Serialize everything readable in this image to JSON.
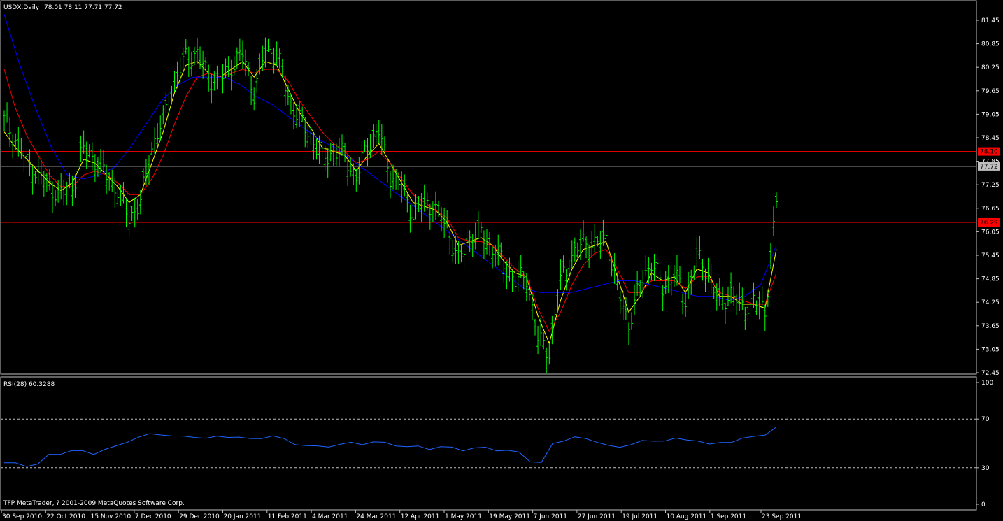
{
  "chart_data": [
    {
      "type": "line",
      "title": "USDX,Daily",
      "ohlc_header": "78.01 78.11 77.71 77.72",
      "ylim": [
        72.45,
        81.75
      ],
      "y_ticks": [
        "81.45",
        "80.85",
        "80.25",
        "79.65",
        "79.05",
        "78.45",
        "77.85",
        "77.25",
        "76.65",
        "76.05",
        "75.45",
        "74.85",
        "74.25",
        "73.65",
        "73.05",
        "72.45"
      ],
      "x_ticks": [
        "30 Sep 2010",
        "22 Oct 2010",
        "15 Nov 2010",
        "7 Dec 2010",
        "29 Dec 2010",
        "20 Jan 2011",
        "11 Feb 2011",
        "4 Mar 2011",
        "24 Mar 2011",
        "12 Apr 2011",
        "1 May 2011",
        "19 May 2011",
        "7 Jun 2011",
        "27 Jun 2011",
        "19 Jul 2011",
        "10 Aug 2011",
        "1 Sep 2011",
        "23 Sep 2011"
      ],
      "hlines": [
        {
          "value": 78.1,
          "label": "78.10",
          "color": "#ff0000"
        },
        {
          "value": 77.72,
          "label": "77.72",
          "color": "#c0c0c0"
        },
        {
          "value": 76.29,
          "label": "76.29",
          "color": "#ff0000"
        }
      ],
      "colors": {
        "bars": "#00ff00",
        "ma_fast": "#ffff00",
        "ma_mid": "#ff0000",
        "ma_slow": "#0000ff"
      },
      "x": [
        0,
        4,
        8,
        12,
        16,
        20,
        24,
        28,
        32,
        36,
        40,
        44,
        48,
        52,
        56,
        60,
        64,
        68,
        72,
        76,
        80,
        84,
        88,
        92,
        96,
        100,
        104,
        108,
        112,
        116,
        120,
        124,
        128,
        132,
        136,
        140,
        144,
        148,
        152,
        156,
        160,
        164,
        168,
        172,
        176,
        180,
        184,
        188,
        192,
        196,
        200,
        204,
        208,
        212,
        216,
        220,
        224,
        228,
        232,
        236,
        240,
        244,
        248,
        252,
        256,
        260,
        264,
        268,
        272
      ],
      "close": [
        78.9,
        78.4,
        77.8,
        77.5,
        77.2,
        77.0,
        77.2,
        78.2,
        77.9,
        77.5,
        77.1,
        76.4,
        76.8,
        78.2,
        78.9,
        79.9,
        80.5,
        80.6,
        80.0,
        79.9,
        80.3,
        80.6,
        79.6,
        80.7,
        80.6,
        79.5,
        78.9,
        78.5,
        77.9,
        78.1,
        78.0,
        77.4,
        78.3,
        78.6,
        77.5,
        77.2,
        76.5,
        76.8,
        76.6,
        76.2,
        75.3,
        75.9,
        76.0,
        75.6,
        75.2,
        74.8,
        74.9,
        73.3,
        73.0,
        74.8,
        75.4,
        75.8,
        75.7,
        75.9,
        74.6,
        73.7,
        74.7,
        75.3,
        74.6,
        75.0,
        74.3,
        75.4,
        75.0,
        74.2,
        74.5,
        74.1,
        74.3,
        74.0,
        76.8
      ],
      "series": [
        {
          "name": "",
          "values": [
            78.6,
            78.2,
            77.9,
            77.6,
            77.3,
            77.1,
            77.3,
            77.9,
            77.8,
            77.5,
            77.2,
            76.8,
            77.0,
            77.8,
            78.6,
            79.6,
            80.3,
            80.4,
            80.1,
            80.0,
            80.2,
            80.4,
            80.0,
            80.4,
            80.3,
            79.7,
            79.1,
            78.7,
            78.2,
            78.1,
            78.0,
            77.6,
            78.0,
            78.3,
            77.8,
            77.3,
            76.8,
            76.7,
            76.6,
            76.3,
            75.7,
            75.8,
            75.9,
            75.7,
            75.3,
            75.0,
            74.9,
            73.9,
            73.2,
            74.3,
            75.1,
            75.6,
            75.7,
            75.8,
            74.9,
            74.0,
            74.4,
            75.0,
            74.8,
            74.9,
            74.5,
            75.1,
            75.0,
            74.4,
            74.4,
            74.2,
            74.2,
            74.1,
            75.6
          ]
        },
        {
          "name": "",
          "values": [
            80.2,
            79.2,
            78.5,
            78.0,
            77.5,
            77.2,
            77.2,
            77.5,
            77.6,
            77.5,
            77.3,
            77.0,
            77.0,
            77.4,
            78.0,
            78.8,
            79.5,
            80.0,
            80.1,
            80.0,
            80.1,
            80.2,
            80.1,
            80.2,
            80.2,
            79.9,
            79.4,
            79.0,
            78.6,
            78.3,
            78.1,
            77.8,
            77.9,
            78.1,
            77.8,
            77.4,
            77.0,
            76.8,
            76.6,
            76.4,
            75.9,
            75.8,
            75.8,
            75.7,
            75.4,
            75.1,
            74.9,
            74.1,
            73.5,
            74.0,
            74.7,
            75.2,
            75.5,
            75.6,
            75.1,
            74.5,
            74.5,
            74.8,
            74.8,
            74.8,
            74.6,
            74.9,
            74.9,
            74.5,
            74.4,
            74.3,
            74.2,
            74.2,
            75.0
          ]
        },
        {
          "name": "",
          "values": [
            81.6,
            80.3,
            79.2,
            78.2,
            77.5,
            77.4,
            77.5,
            77.7,
            78.2,
            78.8,
            79.4,
            79.8,
            80.0,
            80.0,
            80.0,
            79.8,
            79.5,
            79.3,
            79.0,
            78.7,
            78.4,
            78.2,
            77.9,
            77.6,
            77.3,
            77.0,
            76.7,
            76.4,
            76.1,
            75.8,
            75.5,
            75.2,
            74.9,
            74.6,
            74.5,
            74.5,
            74.5,
            74.6,
            74.7,
            74.8,
            74.8,
            74.7,
            74.6,
            74.5,
            74.4,
            74.4,
            74.3,
            74.4,
            74.7,
            75.7
          ]
        }
      ]
    },
    {
      "type": "line",
      "title": "RSI(28) 60.3288",
      "ylim": [
        0,
        100
      ],
      "y_ticks": [
        "100",
        "70",
        "30",
        "0"
      ],
      "levels": [
        70,
        30
      ],
      "color": "#1e64ff",
      "series": [
        {
          "name": "",
          "values": [
            34,
            33,
            32,
            33,
            40,
            42,
            44,
            43,
            42,
            45,
            47,
            52,
            55,
            57,
            58,
            56,
            55,
            56,
            54,
            55,
            56,
            55,
            53,
            55,
            56,
            53,
            50,
            48,
            47,
            48,
            49,
            50,
            50,
            51,
            50,
            49,
            47,
            47,
            46,
            47,
            46,
            45,
            46,
            46,
            45,
            44,
            42,
            36,
            34,
            49,
            53,
            55,
            53,
            52,
            48,
            46,
            50,
            52,
            51,
            53,
            54,
            52,
            53,
            49,
            50,
            52,
            54,
            55,
            58,
            63
          ]
        }
      ]
    }
  ],
  "footer": {
    "copyright": "TFP MetaTrader, ? 2001-2009 MetaQuotes Software Corp."
  }
}
